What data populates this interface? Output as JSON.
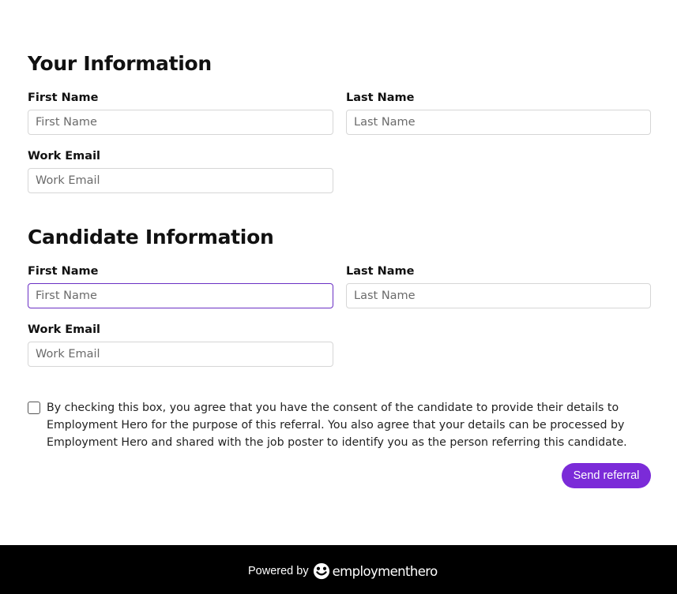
{
  "your_info": {
    "title": "Your Information",
    "first_name": {
      "label": "First Name",
      "placeholder": "First Name"
    },
    "last_name": {
      "label": "Last Name",
      "placeholder": "Last Name"
    },
    "work_email": {
      "label": "Work Email",
      "placeholder": "Work Email"
    }
  },
  "candidate_info": {
    "title": "Candidate Information",
    "first_name": {
      "label": "First Name",
      "placeholder": "First Name"
    },
    "last_name": {
      "label": "Last Name",
      "placeholder": "Last Name"
    },
    "work_email": {
      "label": "Work Email",
      "placeholder": "Work Email"
    }
  },
  "consent": {
    "text": "By checking this box, you agree that you have the consent of the candidate to provide their details to Employment Hero for the purpose of this referral. You also agree that your details can be processed by Employment Hero and shared with the job poster to identify you as the person referring this candidate.",
    "checked": false
  },
  "actions": {
    "send_label": "Send referral"
  },
  "footer": {
    "powered_by": "Powered by",
    "brand": "employmenthero",
    "brand_icon": "employment-hero-logo-icon"
  },
  "colors": {
    "accent": "#7b2bd8",
    "focus_border": "#6a2fc4",
    "footer_bg": "#000000"
  }
}
